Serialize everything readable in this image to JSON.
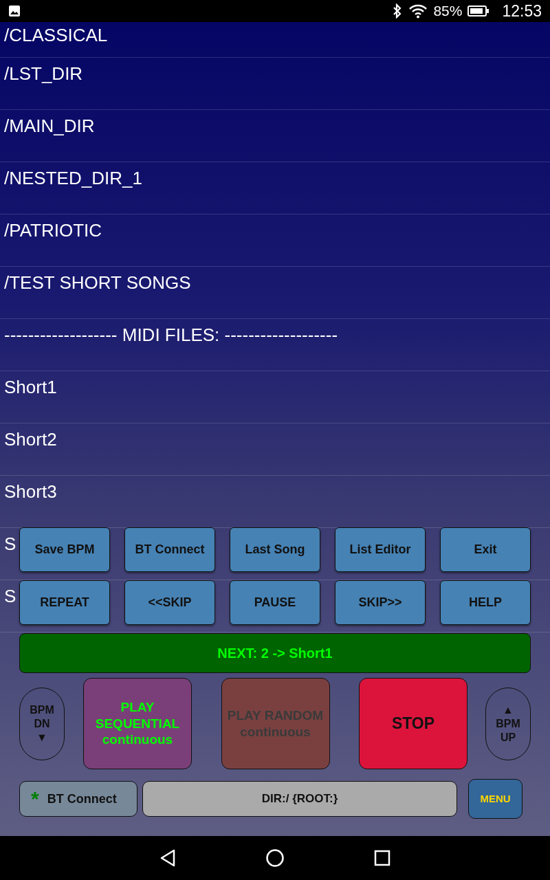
{
  "status_bar": {
    "battery": "85%",
    "time": "12:53"
  },
  "list": [
    {
      "text": "/CLASSICAL"
    },
    {
      "text": "/LST_DIR"
    },
    {
      "text": "/MAIN_DIR"
    },
    {
      "text": "/NESTED_DIR_1"
    },
    {
      "text": "/PATRIOTIC"
    },
    {
      "text": "/TEST SHORT SONGS"
    },
    {
      "text": "------------------- MIDI FILES: -------------------"
    },
    {
      "text": "Short1"
    },
    {
      "text": "Short2"
    },
    {
      "text": "Short3"
    },
    {
      "text": "S"
    },
    {
      "text": "S"
    }
  ],
  "button_rows": [
    [
      "Save BPM",
      "BT Connect",
      "Last Song",
      "List Editor",
      "Exit"
    ],
    [
      "REPEAT",
      "<<SKIP",
      "PAUSE",
      "SKIP>>",
      "HELP"
    ]
  ],
  "next": "NEXT: 2 -> Short1",
  "bpm_down": [
    "BPM",
    "DN",
    "▼"
  ],
  "play_buttons": [
    {
      "kind": "play",
      "lines": [
        "PLAY",
        "SEQUENTIAL",
        "continuous"
      ],
      "selected": true
    },
    {
      "kind": "play",
      "lines": [
        "PLAY RANDOM",
        "continuous"
      ],
      "selected": false
    },
    {
      "kind": "stop",
      "lines": [
        "STOP"
      ]
    }
  ],
  "bpm_up": [
    "▲",
    "BPM",
    "UP"
  ],
  "bt_button": {
    "icon": "*",
    "label": "BT Connect"
  },
  "dir": "DIR:/ {ROOT:}",
  "menu": "MENU"
}
